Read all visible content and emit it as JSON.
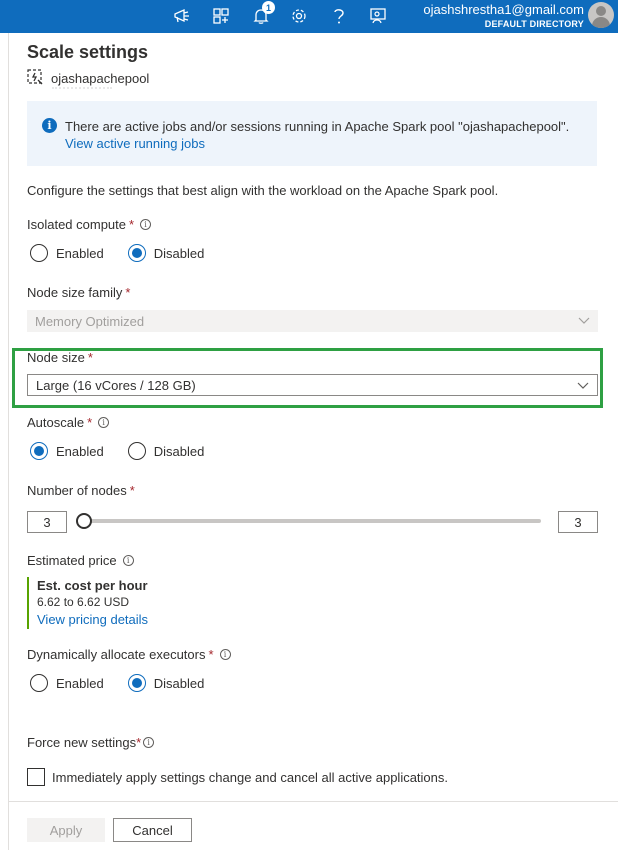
{
  "topbar": {
    "notification_count": "1",
    "account_email": "ojashshrestha1@gmail.com",
    "directory": "DEFAULT DIRECTORY",
    "icons": [
      "feedback-megaphone-icon",
      "portal-directory-icon",
      "notifications-bell-icon",
      "settings-gear-icon",
      "help-question-icon",
      "feedback-person-icon"
    ]
  },
  "panel": {
    "title": "Scale settings",
    "resource_name": "ojashapachepool"
  },
  "info": {
    "message": "There are active jobs and/or sessions running in Apache Spark pool \"ojashapachepool\".",
    "link": "View active running jobs"
  },
  "description": "Configure the settings that best align with the workload on the Apache Spark pool.",
  "isolated_compute": {
    "label": "Isolated compute",
    "required_mark": "*",
    "options": [
      "Enabled",
      "Disabled"
    ],
    "selected": "Disabled"
  },
  "node_size_family": {
    "label": "Node size family",
    "required_mark": "*",
    "value": "Memory Optimized"
  },
  "node_size": {
    "label": "Node size",
    "required_mark": "*",
    "value": "Large (16 vCores / 128 GB)"
  },
  "autoscale": {
    "label": "Autoscale",
    "required_mark": "*",
    "options": [
      "Enabled",
      "Disabled"
    ],
    "selected": "Enabled"
  },
  "number_of_nodes": {
    "label": "Number of nodes",
    "required_mark": "*",
    "min_value": "3",
    "max_value": "3",
    "slider_fraction": 0.0
  },
  "estimated_price": {
    "label": "Estimated price",
    "cost_title": "Est. cost per hour",
    "cost_value": "6.62 to 6.62 USD",
    "link": "View pricing details"
  },
  "dynamic_executors": {
    "label": "Dynamically allocate executors",
    "required_mark": "*",
    "options": [
      "Enabled",
      "Disabled"
    ],
    "selected": "Disabled"
  },
  "force_new_settings": {
    "label": "Force new settings",
    "required_mark": "*",
    "checkbox_label": "Immediately apply settings change and cancel all active applications.",
    "checked": false
  },
  "buttons": {
    "apply": "Apply",
    "cancel": "Cancel"
  },
  "colors": {
    "accent": "#0f6cbd",
    "highlight_box": "#2ea043",
    "price_bar": "#57a300"
  }
}
